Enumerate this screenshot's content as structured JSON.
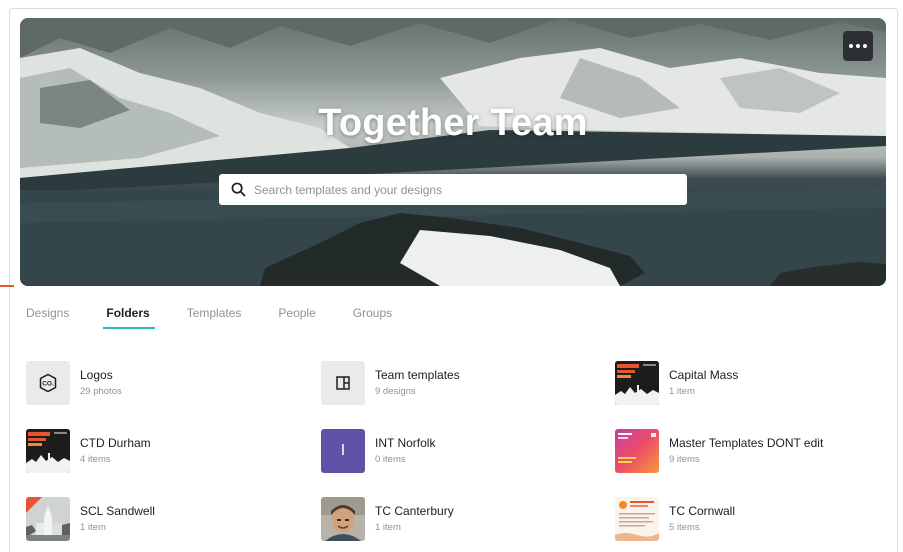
{
  "hero": {
    "title": "Together Team",
    "search_placeholder": "Search templates and your designs",
    "more_icon": "more-horizontal-icon"
  },
  "tabs": [
    {
      "label": "Designs",
      "active": false
    },
    {
      "label": "Folders",
      "active": true
    },
    {
      "label": "Templates",
      "active": false
    },
    {
      "label": "People",
      "active": false
    },
    {
      "label": "Groups",
      "active": false
    }
  ],
  "folders": [
    {
      "name": "Logos",
      "count": "29 photos",
      "thumb": "logo-co-icon"
    },
    {
      "name": "Team templates",
      "count": "9 designs",
      "thumb": "template-layout-icon"
    },
    {
      "name": "Capital Mass",
      "count": "1 item",
      "thumb": "poster-dark"
    },
    {
      "name": "CTD Durham",
      "count": "4 items",
      "thumb": "poster-dark"
    },
    {
      "name": "INT Norfolk",
      "count": "0 items",
      "thumb": "letter-tile",
      "letter": "I"
    },
    {
      "name": "Master Templates DONT edit",
      "count": "9 items",
      "thumb": "gradient-poster"
    },
    {
      "name": "SCL Sandwell",
      "count": "1 item",
      "thumb": "church-photo"
    },
    {
      "name": "TC Canterbury",
      "count": "1 item",
      "thumb": "portrait-photo"
    },
    {
      "name": "TC Cornwall",
      "count": "5 items",
      "thumb": "flyer-light"
    }
  ],
  "colors": {
    "accent_tab": "#2ab5b7",
    "purple_tile": "#5d52a6",
    "muted_text": "#8e9297"
  }
}
